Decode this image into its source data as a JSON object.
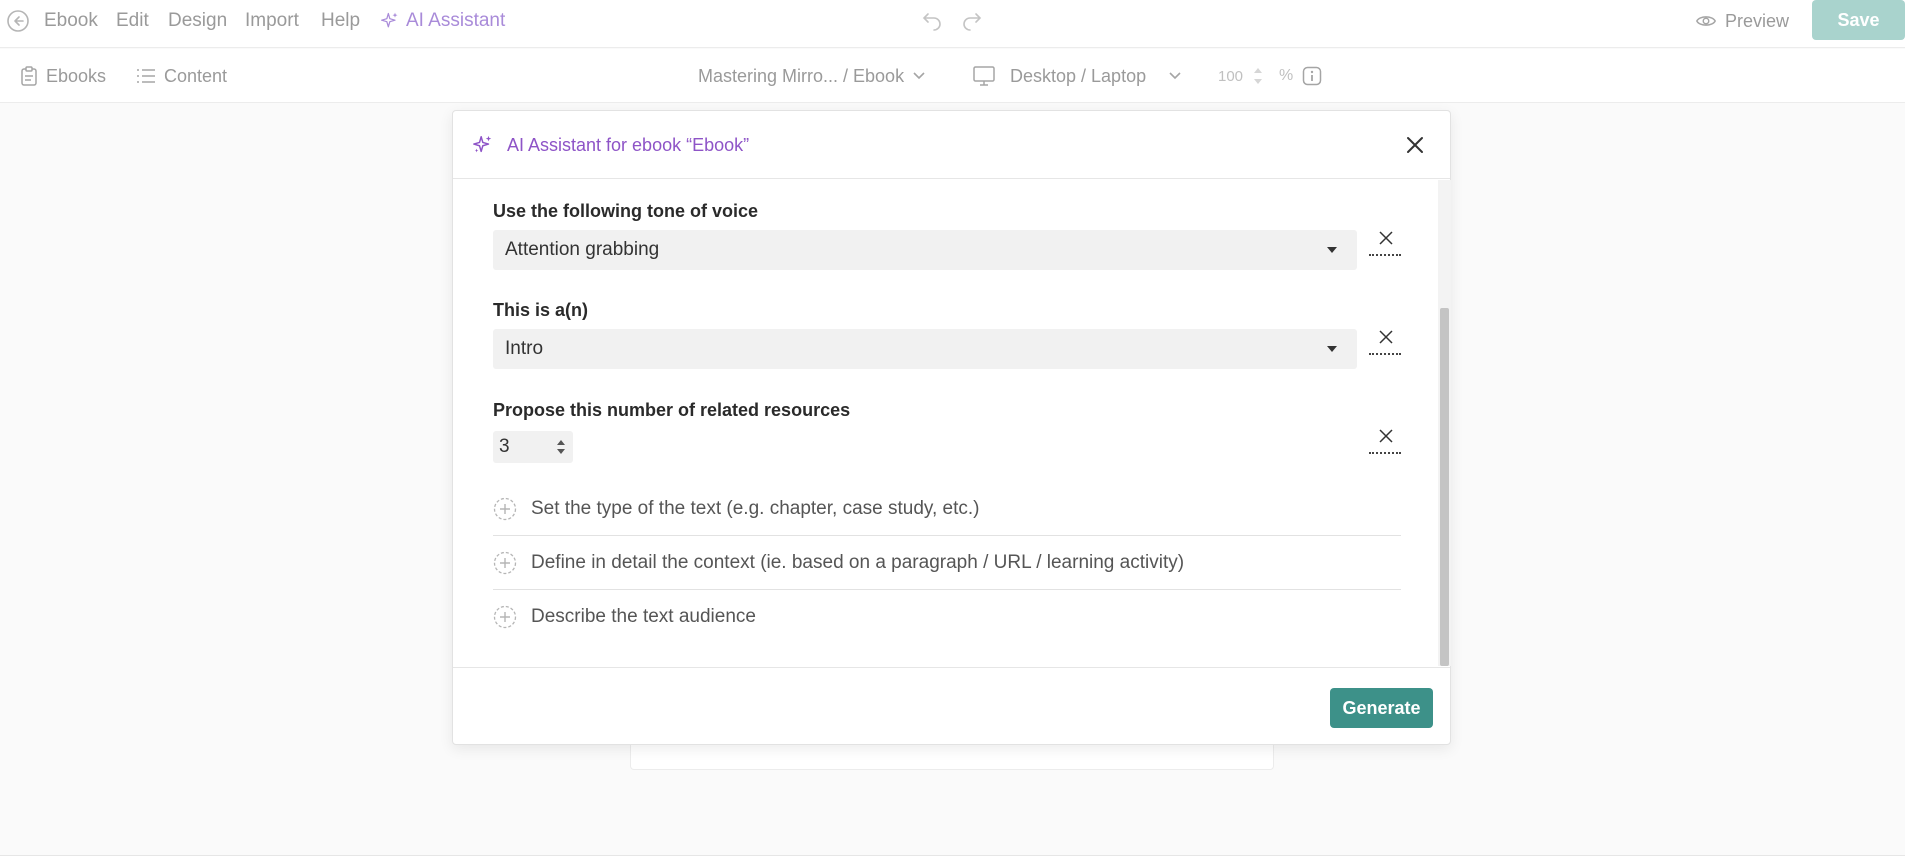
{
  "topbar": {
    "menu": [
      "Ebook",
      "Edit",
      "Design",
      "Import",
      "Help"
    ],
    "ai_assistant": "AI Assistant",
    "preview": "Preview",
    "save": "Save"
  },
  "toolbar": {
    "ebooks": "Ebooks",
    "content": "Content",
    "breadcrumb": "Mastering Mirro... / Ebook",
    "device": "Desktop / Laptop",
    "zoom_value": "100",
    "zoom_unit": "%"
  },
  "modal": {
    "title": "AI Assistant for ebook “Ebook”",
    "tone_label": "Use the following tone of voice",
    "tone_value": "Attention grabbing",
    "type_label": "This is a(n)",
    "type_value": "Intro",
    "resources_label": "Propose this number of related resources",
    "resources_value": "3",
    "options": [
      "Set the type of the text (e.g. chapter, case study, etc.)",
      "Define in detail the context (ie. based on a paragraph / URL / learning activity)",
      "Describe the text audience"
    ],
    "generate": "Generate"
  },
  "colors": {
    "accent_purple": "#8e54c7",
    "generate_green": "#3d9189",
    "save_disabled": "#a9d3cd"
  }
}
